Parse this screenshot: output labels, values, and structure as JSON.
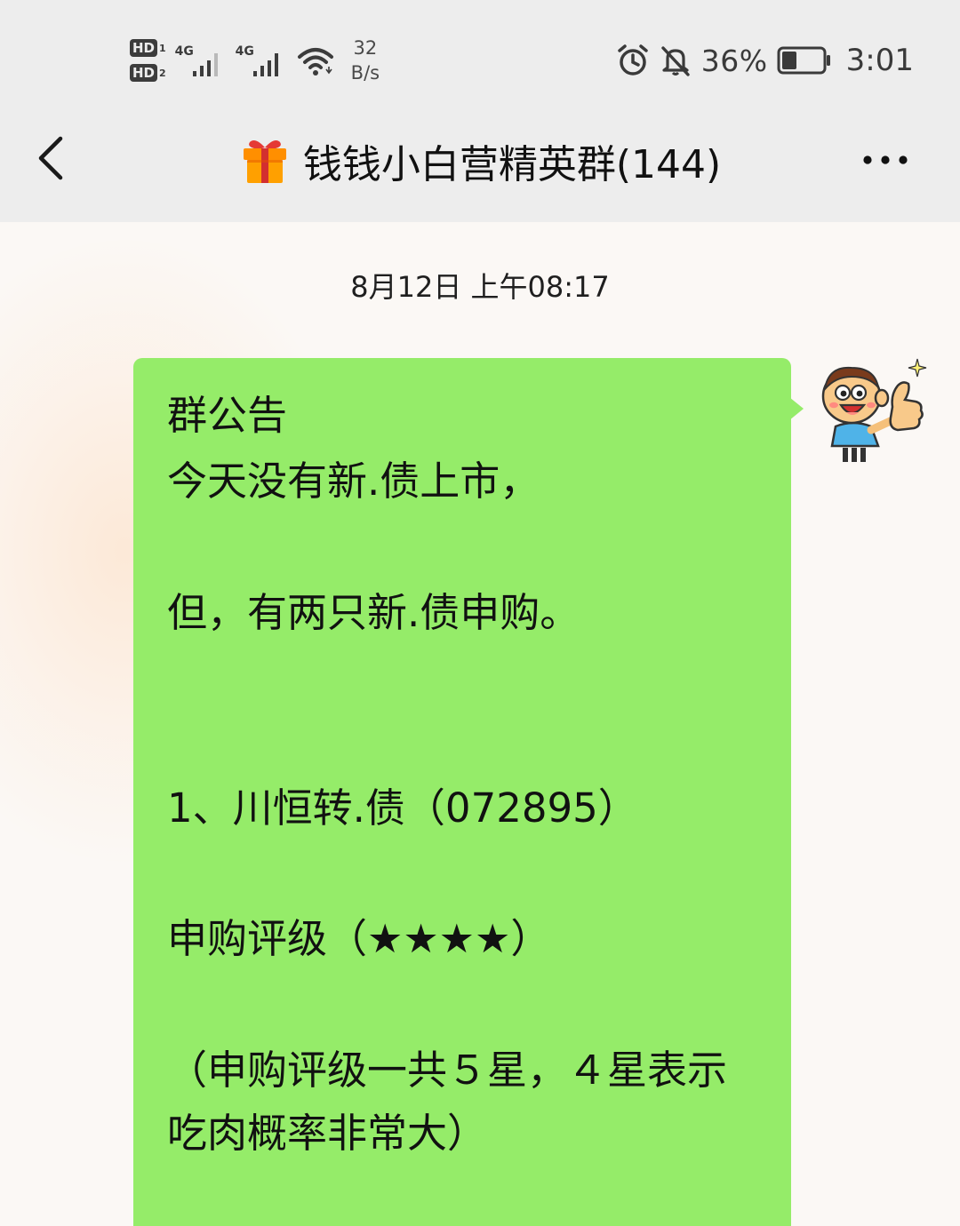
{
  "status_bar": {
    "sim1_label": "HD",
    "sim1_index": "1",
    "sim2_label": "HD",
    "sim2_index": "2",
    "net1": "4G",
    "net2": "4G",
    "speed_value": "32",
    "speed_unit": "B/s",
    "battery_percent": "36%",
    "battery_level": 0.36,
    "time": "3:01",
    "icons": [
      "sim-hd-icon",
      "signal-icon",
      "wifi-icon",
      "alarm-icon",
      "mute-icon",
      "battery-icon"
    ]
  },
  "header": {
    "title": "钱钱小白营精英群(144)",
    "title_emoji": "gift-box-icon",
    "back_icon": "back-chevron-icon",
    "more_icon": "more-dots-icon"
  },
  "chat": {
    "timestamp": "8月12日 上午08:17",
    "message": {
      "sender_avatar": "cartoon-thumbs-up-avatar",
      "bubble_color": "#95ec69",
      "lines": [
        "群公告",
        "今天没有新.债上市，",
        "但，有两只新.债申购。",
        "1、川恒转.债（072895）",
        "申购评级（★★★★）",
        "（申购评级一共５星，４星表示",
        "吃肉概率非常大）"
      ]
    }
  },
  "colors": {
    "header_bg": "#ededed",
    "chat_bg": "#fbf8f5",
    "bubble": "#95ec69",
    "text": "#111111"
  }
}
